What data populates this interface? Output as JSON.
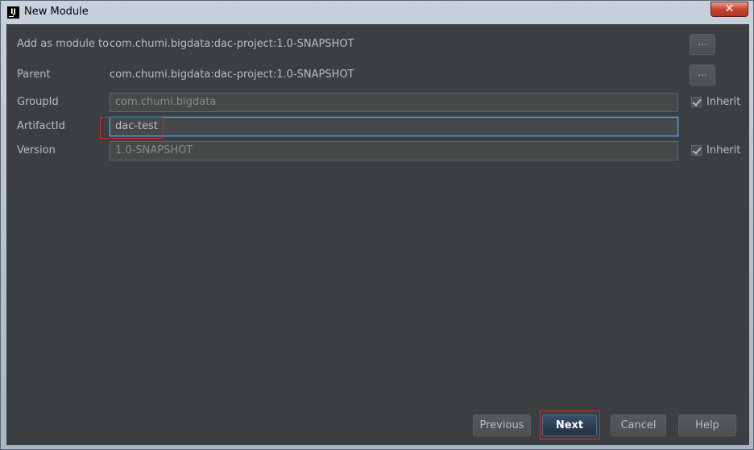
{
  "window": {
    "title": "New Module",
    "close_symbol": "✕"
  },
  "rows": {
    "add_as_module": {
      "label": "Add as module to",
      "value": "com.chumi.bigdata:dac-project:1.0-SNAPSHOT",
      "button": "..."
    },
    "parent": {
      "label": "Parent",
      "value": "com.chumi.bigdata:dac-project:1.0-SNAPSHOT",
      "button": "..."
    },
    "group_id": {
      "label": "GroupId",
      "value": "com.chumi.bigdata",
      "inherit": "Inherit",
      "inherit_checked": true
    },
    "artifact_id": {
      "label": "ArtifactId",
      "value": "dac-test"
    },
    "version": {
      "label": "Version",
      "value": "1.0-SNAPSHOT",
      "inherit": "Inherit",
      "inherit_checked": true
    }
  },
  "buttons": {
    "previous": "Previous",
    "next": "Next",
    "cancel": "Cancel",
    "help": "Help"
  },
  "icons": {
    "app": "intellij-icon",
    "close": "close-icon",
    "checkbox": "checkmark-icon"
  },
  "colors": {
    "background": "#3c3f41",
    "text": "#bbbbbb",
    "focus_border": "#6b9bd1",
    "annotation_red": "#e0262a",
    "primary_button": "#2c3e55"
  }
}
